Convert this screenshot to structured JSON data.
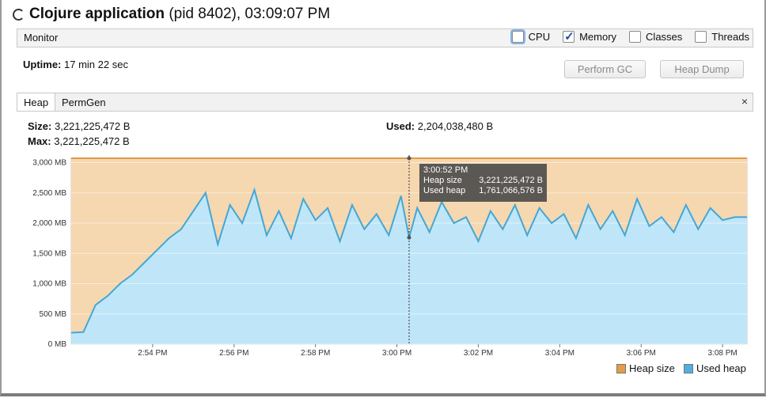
{
  "window": {
    "app_name": "Clojure application",
    "pid_time": "(pid 8402), 03:09:07 PM"
  },
  "monitor": {
    "label": "Monitor",
    "checkboxes": [
      {
        "label": "CPU",
        "checked": false
      },
      {
        "label": "Memory",
        "checked": true
      },
      {
        "label": "Classes",
        "checked": false
      },
      {
        "label": "Threads",
        "checked": false
      }
    ]
  },
  "uptime": {
    "label": "Uptime:",
    "value": "17 min 22 sec"
  },
  "buttons": {
    "gc": "Perform GC",
    "dump": "Heap Dump"
  },
  "tabs": {
    "heap": "Heap",
    "permgen": "PermGen",
    "close": "×"
  },
  "heap_info": {
    "size_label": "Size:",
    "size_value": "3,221,225,472 B",
    "max_label": "Max:",
    "max_value": "3,221,225,472 B",
    "used_label": "Used:",
    "used_value": "2,204,038,480 B"
  },
  "tooltip": {
    "time": "3:00:52 PM",
    "heap_label": "Heap size",
    "heap_value": "3,221,225,472 B",
    "used_label": "Used heap",
    "used_value": "1,761,066,576 B"
  },
  "legend": {
    "heap": "Heap size",
    "used": "Used heap"
  },
  "colors": {
    "heap": "#f5d7b0",
    "heap_line": "#e09a4a",
    "used": "#bfe6f8",
    "used_line": "#45a6d6"
  },
  "chart_data": {
    "type": "area",
    "title": "",
    "xlabel": "",
    "ylabel": "",
    "ylim": [
      0,
      3072
    ],
    "y_ticks": [
      "0 MB",
      "500 MB",
      "1,000 MB",
      "1,500 MB",
      "2,000 MB",
      "2,500 MB",
      "3,000 MB"
    ],
    "y_tick_values": [
      0,
      500,
      1000,
      1500,
      2000,
      2500,
      3000
    ],
    "x_ticks": [
      "2:54 PM",
      "2:56 PM",
      "2:58 PM",
      "3:00 PM",
      "3:02 PM",
      "3:04 PM",
      "3:06 PM",
      "3:08 PM"
    ],
    "x_tick_values": [
      2,
      4,
      6,
      8,
      10,
      12,
      14,
      16
    ],
    "xlim": [
      0.0,
      16.6
    ],
    "marker_x": 8.3,
    "series": [
      {
        "name": "Heap size",
        "x": [
          0,
          16.6
        ],
        "values": [
          3072,
          3072
        ]
      },
      {
        "name": "Used heap",
        "x": [
          0,
          0.3,
          0.6,
          0.9,
          1.2,
          1.5,
          1.8,
          2.1,
          2.4,
          2.7,
          3.0,
          3.3,
          3.6,
          3.9,
          4.2,
          4.5,
          4.8,
          5.1,
          5.4,
          5.7,
          6.0,
          6.3,
          6.6,
          6.9,
          7.2,
          7.5,
          7.8,
          8.1,
          8.3,
          8.5,
          8.8,
          9.1,
          9.4,
          9.7,
          10.0,
          10.3,
          10.6,
          10.9,
          11.2,
          11.5,
          11.8,
          12.1,
          12.4,
          12.7,
          13.0,
          13.3,
          13.6,
          13.9,
          14.2,
          14.5,
          14.8,
          15.1,
          15.4,
          15.7,
          16.0,
          16.3,
          16.6
        ],
        "values": [
          190,
          200,
          650,
          800,
          1000,
          1150,
          1350,
          1550,
          1750,
          1900,
          2200,
          2500,
          1650,
          2300,
          2000,
          2550,
          1800,
          2200,
          1750,
          2400,
          2050,
          2250,
          1700,
          2300,
          1900,
          2150,
          1800,
          2450,
          1760,
          2250,
          1850,
          2350,
          2000,
          2100,
          1700,
          2200,
          1900,
          2300,
          1800,
          2250,
          2000,
          2150,
          1750,
          2300,
          1900,
          2200,
          1800,
          2400,
          1950,
          2100,
          1850,
          2300,
          1900,
          2250,
          2050,
          2100,
          2100
        ]
      }
    ]
  }
}
